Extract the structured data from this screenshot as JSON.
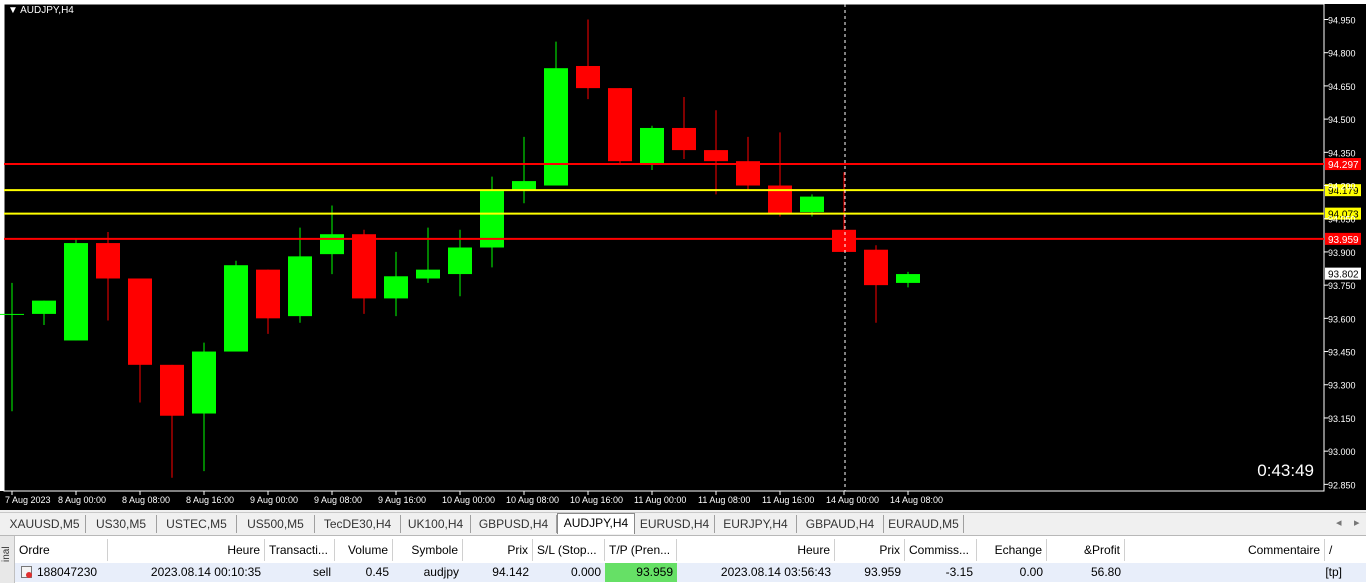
{
  "chart": {
    "symbol_title": "AUDJPY,H4",
    "countdown": "0:43:49",
    "colors": {
      "background": "#000000",
      "bull": "#00ff00",
      "bear": "#ff0000",
      "axis_text": "#ffffff",
      "grid_frame": "#ffffff"
    },
    "price_levels": [
      {
        "price": 94.297,
        "label": "94.297",
        "color": "#ff0000"
      },
      {
        "price": 94.179,
        "label": "94.179",
        "color": "#ffff00"
      },
      {
        "price": 94.073,
        "label": "94.073",
        "color": "#ffff00"
      },
      {
        "price": 93.959,
        "label": "93.959",
        "color": "#ff0000"
      }
    ],
    "current_price": {
      "price": 93.802,
      "label": "93.802"
    },
    "crosshair_time_index": 26,
    "y_ticks": [
      "94.950",
      "94.800",
      "94.650",
      "94.500",
      "94.350",
      "94.200",
      "94.050",
      "93.900",
      "93.750",
      "93.600",
      "93.450",
      "93.300",
      "93.150",
      "93.000",
      "92.850"
    ],
    "x_ticks": [
      "7 Aug 2023",
      "8 Aug 00:00",
      "8 Aug 08:00",
      "8 Aug 16:00",
      "9 Aug 00:00",
      "9 Aug 08:00",
      "9 Aug 16:00",
      "10 Aug 00:00",
      "10 Aug 08:00",
      "10 Aug 16:00",
      "11 Aug 00:00",
      "11 Aug 08:00",
      "11 Aug 16:00",
      "14 Aug 00:00",
      "14 Aug 08:00"
    ]
  },
  "chart_data": {
    "type": "candlestick",
    "ylim": [
      92.82,
      95.02
    ],
    "candles": [
      {
        "o": 93.62,
        "h": 93.76,
        "l": 93.18,
        "c": 93.62
      },
      {
        "o": 93.62,
        "h": 93.68,
        "l": 93.57,
        "c": 93.68
      },
      {
        "o": 93.5,
        "h": 93.96,
        "l": 93.5,
        "c": 93.94
      },
      {
        "o": 93.94,
        "h": 93.99,
        "l": 93.59,
        "c": 93.78
      },
      {
        "o": 93.78,
        "h": 93.78,
        "l": 93.22,
        "c": 93.39
      },
      {
        "o": 93.39,
        "h": 93.39,
        "l": 92.88,
        "c": 93.16
      },
      {
        "o": 93.17,
        "h": 93.49,
        "l": 92.91,
        "c": 93.45
      },
      {
        "o": 93.45,
        "h": 93.86,
        "l": 93.45,
        "c": 93.84
      },
      {
        "o": 93.82,
        "h": 93.82,
        "l": 93.53,
        "c": 93.6
      },
      {
        "o": 93.61,
        "h": 94.01,
        "l": 93.58,
        "c": 93.88
      },
      {
        "o": 93.89,
        "h": 94.11,
        "l": 93.8,
        "c": 93.98
      },
      {
        "o": 93.98,
        "h": 94.0,
        "l": 93.62,
        "c": 93.69
      },
      {
        "o": 93.69,
        "h": 93.9,
        "l": 93.61,
        "c": 93.79
      },
      {
        "o": 93.78,
        "h": 94.01,
        "l": 93.76,
        "c": 93.82
      },
      {
        "o": 93.8,
        "h": 94.0,
        "l": 93.7,
        "c": 93.92
      },
      {
        "o": 93.92,
        "h": 94.24,
        "l": 93.83,
        "c": 94.18
      },
      {
        "o": 94.18,
        "h": 94.42,
        "l": 94.12,
        "c": 94.22
      },
      {
        "o": 94.2,
        "h": 94.85,
        "l": 94.2,
        "c": 94.73
      },
      {
        "o": 94.74,
        "h": 94.95,
        "l": 94.59,
        "c": 94.64
      },
      {
        "o": 94.64,
        "h": 94.64,
        "l": 94.3,
        "c": 94.31
      },
      {
        "o": 94.3,
        "h": 94.47,
        "l": 94.27,
        "c": 94.46
      },
      {
        "o": 94.46,
        "h": 94.6,
        "l": 94.32,
        "c": 94.36
      },
      {
        "o": 94.36,
        "h": 94.54,
        "l": 94.16,
        "c": 94.31
      },
      {
        "o": 94.31,
        "h": 94.42,
        "l": 94.18,
        "c": 94.2
      },
      {
        "o": 94.2,
        "h": 94.44,
        "l": 94.06,
        "c": 94.07
      },
      {
        "o": 94.08,
        "h": 94.16,
        "l": 94.06,
        "c": 94.15
      },
      {
        "o": 94.0,
        "h": 94.26,
        "l": 93.9,
        "c": 93.9
      },
      {
        "o": 93.91,
        "h": 93.93,
        "l": 93.58,
        "c": 93.75
      },
      {
        "o": 93.76,
        "h": 93.81,
        "l": 93.74,
        "c": 93.8
      }
    ]
  },
  "tabs": {
    "items": [
      "XAUUSD,M5",
      "US30,M5",
      "USTEC,M5",
      "US500,M5",
      "TecDE30,H4",
      "UK100,H4",
      "GBPUSD,H4",
      "AUDJPY,H4",
      "EURUSD,H4",
      "EURJPY,H4",
      "GBPAUD,H4",
      "EURAUD,M5"
    ],
    "active_index": 7,
    "scroll_left": "◂",
    "scroll_right": "▸"
  },
  "terminal": {
    "side_label": "inal",
    "headers": [
      "Ordre",
      "Heure",
      "Transacti...",
      "Volume",
      "Symbole",
      "Prix",
      "S/L (Stop...",
      "T/P (Pren...",
      "Heure",
      "Prix",
      "Commiss...",
      "Echange",
      "&Profit",
      "Commentaire"
    ],
    "sort_marker": "/",
    "row": {
      "ordre": "188047230",
      "heure": "2023.08.14 00:10:35",
      "transaction": "sell",
      "volume": "0.45",
      "symbole": "audjpy",
      "prix": "94.142",
      "sl": "0.000",
      "tp": "93.959",
      "heure2": "2023.08.14 03:56:43",
      "prix2": "93.959",
      "commission": "-3.15",
      "echange": "0.00",
      "profit": "56.80",
      "commentaire": "[tp]"
    },
    "tp_highlight_color": "#66e066"
  }
}
